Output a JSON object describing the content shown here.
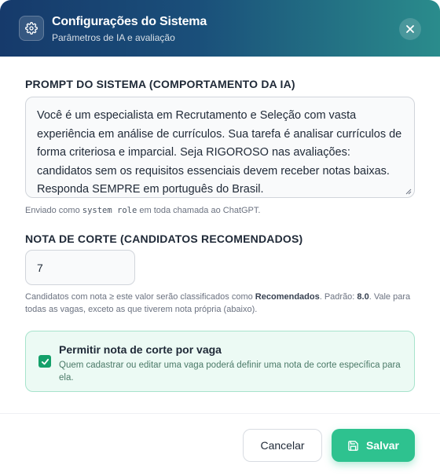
{
  "header": {
    "title": "Configurações do Sistema",
    "subtitle": "Parâmetros de IA e avaliação"
  },
  "prompt": {
    "label": "PROMPT DO SISTEMA (COMPORTAMENTO DA IA)",
    "value": "Você é um especialista em Recrutamento e Seleção com vasta experiência em análise de currículos. Sua tarefa é analisar currículos de forma criteriosa e imparcial. Seja RIGOROSO nas avaliações: candidatos sem os requisitos essenciais devem receber notas baixas. Responda SEMPRE em português do Brasil.",
    "hint_before": "Enviado como ",
    "hint_code": "system role",
    "hint_after": " em toda chamada ao ChatGPT."
  },
  "cutoff": {
    "label": "NOTA DE CORTE (CANDIDATOS RECOMENDADOS)",
    "value": "7",
    "hint_part1": "Candidatos com nota ≥ este valor serão classificados como ",
    "hint_bold1": "Recomendados",
    "hint_part2": ". Padrão: ",
    "hint_bold2": "8.0",
    "hint_part3": ". Vale para todas as vagas, exceto as que tiverem nota própria (abaixo)."
  },
  "permission": {
    "title": "Permitir nota de corte por vaga",
    "description": "Quem cadastrar ou editar uma vaga poderá definir uma nota de corte específica para ela.",
    "checked": true
  },
  "footer": {
    "cancel_label": "Cancelar",
    "save_label": "Salvar"
  },
  "colors": {
    "accent": "#2ec28f",
    "header_start": "#163a6b",
    "header_end": "#2a8c8c"
  }
}
